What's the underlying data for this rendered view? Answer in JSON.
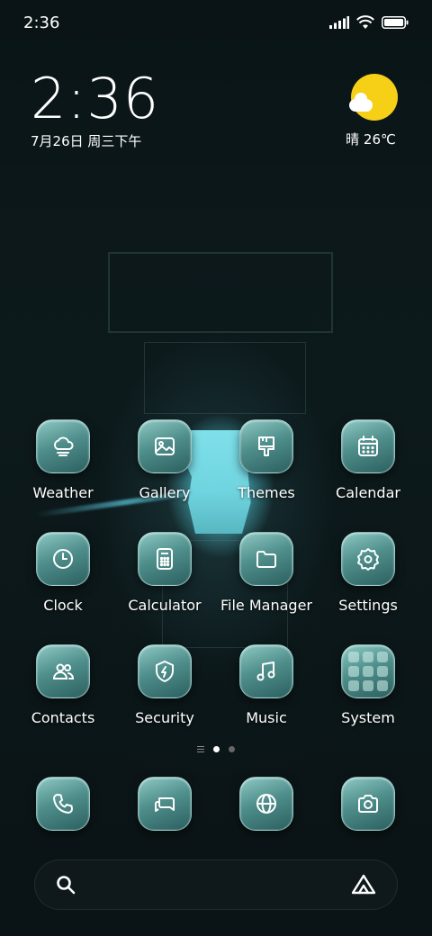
{
  "status_bar": {
    "time": "2:36"
  },
  "clock_widget": {
    "time": "2:36",
    "date": "7月26日 周三下午"
  },
  "weather_widget": {
    "condition_icon": "sun-cloud-icon",
    "text": "晴 26℃"
  },
  "apps": [
    {
      "label": "Weather",
      "icon": "cloud-icon"
    },
    {
      "label": "Gallery",
      "icon": "image-icon"
    },
    {
      "label": "Themes",
      "icon": "brush-icon"
    },
    {
      "label": "Calendar",
      "icon": "calendar-icon"
    },
    {
      "label": "Clock",
      "icon": "clock-icon"
    },
    {
      "label": "Calculator",
      "icon": "calculator-icon"
    },
    {
      "label": "File Manager",
      "icon": "folder-icon"
    },
    {
      "label": "Settings",
      "icon": "gear-icon"
    },
    {
      "label": "Contacts",
      "icon": "contacts-icon"
    },
    {
      "label": "Security",
      "icon": "shield-icon"
    },
    {
      "label": "Music",
      "icon": "music-icon"
    },
    {
      "label": "System",
      "icon": "folder-grid-icon"
    }
  ],
  "dock": [
    {
      "icon": "phone-icon"
    },
    {
      "icon": "message-icon"
    },
    {
      "icon": "globe-icon"
    },
    {
      "icon": "camera-icon"
    }
  ],
  "page_indicator": {
    "pages": 2,
    "active_page": 1
  },
  "colors": {
    "icon_gradient_top": "#8fc9c4",
    "icon_gradient_bottom": "#2c5f60",
    "sun": "#f6cf17",
    "shaft_light": "#7fe0ea"
  }
}
